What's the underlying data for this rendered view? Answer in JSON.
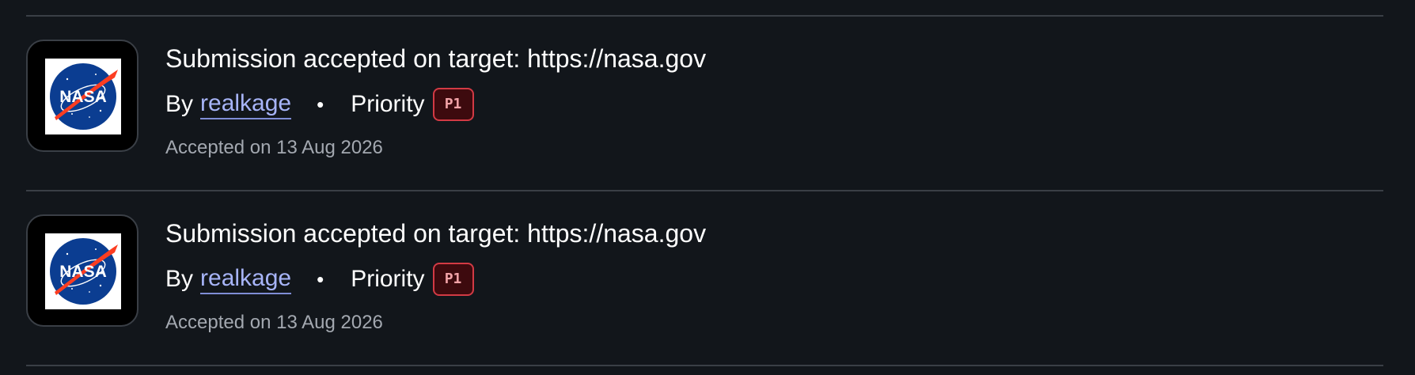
{
  "items": [
    {
      "title": "Submission accepted on target: https://nasa.gov",
      "by_label": "By",
      "author": "realkage",
      "separator": "•",
      "priority_label": "Priority",
      "priority": "P1",
      "accepted": "Accepted on 13 Aug 2026",
      "logo_icon": "nasa-logo-icon",
      "logo_text": "NASA"
    },
    {
      "title": "Submission accepted on target: https://nasa.gov",
      "by_label": "By",
      "author": "realkage",
      "separator": "•",
      "priority_label": "Priority",
      "priority": "P1",
      "accepted": "Accepted on 13 Aug 2026",
      "logo_icon": "nasa-logo-icon",
      "logo_text": "NASA"
    }
  ],
  "colors": {
    "background": "#12161b",
    "divider": "#3a3f46",
    "link": "#a7b4f8",
    "badge_bg": "#3d0a0e",
    "badge_border": "#d23a44",
    "badge_text": "#f2a3a8",
    "muted_text": "#a3a8b0"
  }
}
